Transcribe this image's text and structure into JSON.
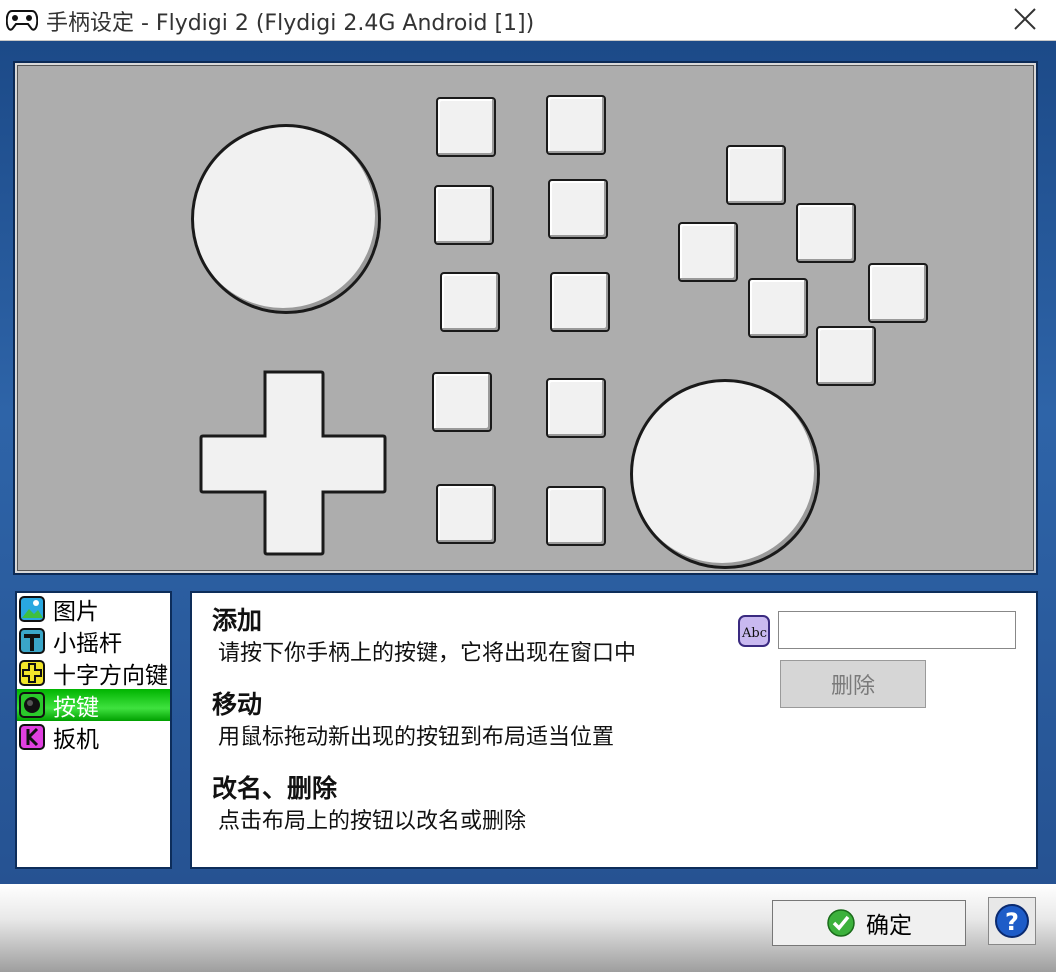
{
  "window": {
    "title": "手柄设定 - Flydigi 2 (Flydigi 2.4G Android [1])",
    "icon": "gamepad-icon"
  },
  "sidebar": {
    "items": [
      {
        "label": "图片",
        "icon": "picture-icon",
        "selected": false
      },
      {
        "label": "小摇杆",
        "icon": "joystick-icon",
        "selected": false
      },
      {
        "label": "十字方向键",
        "icon": "dpad-icon",
        "selected": false
      },
      {
        "label": "按键",
        "icon": "button-icon",
        "selected": true
      },
      {
        "label": "扳机",
        "icon": "trigger-icon",
        "selected": false
      }
    ]
  },
  "panel": {
    "sections": [
      {
        "heading": "添加",
        "body": "请按下你手柄上的按键，它将出现在窗口中"
      },
      {
        "heading": "移动",
        "body": "用鼠标拖动新出现的按钮到布局适当位置"
      },
      {
        "heading": "改名、删除",
        "body": "点击布局上的按钮以改名或删除"
      }
    ],
    "name_field": {
      "value": "",
      "placeholder": ""
    },
    "delete_label": "删除"
  },
  "footer": {
    "ok_label": "确定",
    "help_icon": "help-icon"
  },
  "colors": {
    "selected_green": "#1fcf1f",
    "stage_gray": "#adadad",
    "frame_blue": "#1e4a86"
  }
}
